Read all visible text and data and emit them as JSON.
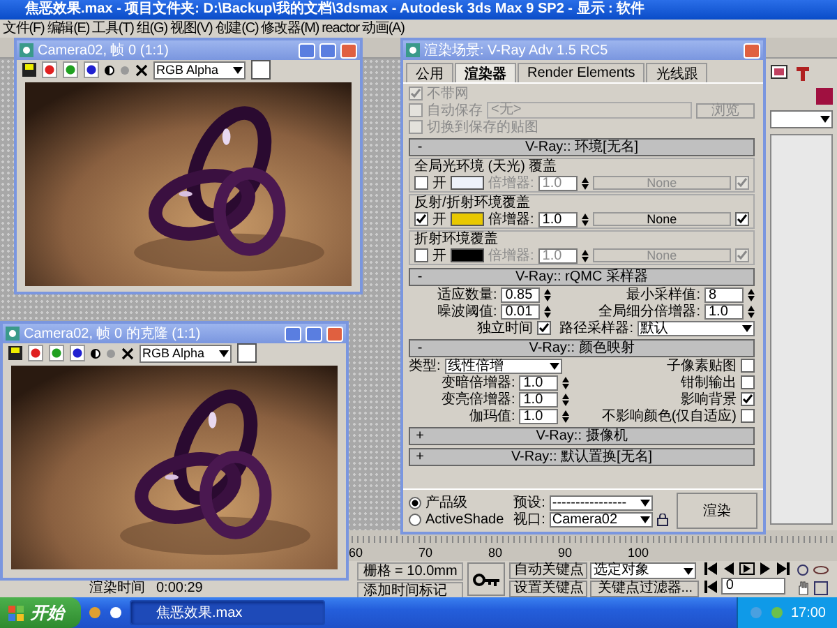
{
  "app_window": {
    "title": "焦恶效果.max    - 项目文件夹: D:\\Backup\\我的文档\\3dsmax    - Autodesk 3ds Max 9 SP2    - 显示 : 软件"
  },
  "menu": [
    "文件(F)",
    "编辑(E)",
    "工具(T)",
    "组(G)",
    "视图(V)",
    "创建(C)",
    "修改器(M)",
    "reactor",
    "动画(A)"
  ],
  "frame_windows": [
    {
      "title": "Camera02, 帧 0 (1:1)",
      "channel": "RGB Alpha"
    },
    {
      "title": "Camera02, 帧 0 的克隆 (1:1)",
      "channel": "RGB Alpha"
    }
  ],
  "render_dialog": {
    "title": "渲染场景: V-Ray Adv 1.5 RC5",
    "tabs": [
      {
        "label": "公用",
        "selected": false
      },
      {
        "label": "渲染器",
        "selected": true
      },
      {
        "label": "Render Elements",
        "selected": false
      },
      {
        "label": "光线跟",
        "selected": false
      }
    ],
    "output_options": [
      {
        "label": "不带网",
        "checked": true
      },
      {
        "label": "自动保存",
        "checked": false,
        "field": "<无>",
        "button": "浏览"
      },
      {
        "label": "切换到保存的贴图",
        "checked": false
      }
    ],
    "rollouts": [
      {
        "kind": "environment",
        "sign": "-",
        "title": "V-Ray:: 环境[无名]",
        "groups": [
          {
            "title": "全局光环境 (天光) 覆盖",
            "on_label": "开",
            "on": false,
            "color": "#eef2fa",
            "multiplier_label": "倍增器:",
            "multiplier": "1.0",
            "map": "None",
            "map_on": true
          },
          {
            "title": "反射/折射环境覆盖",
            "on_label": "开",
            "on": true,
            "color": "#e8c800",
            "multiplier_label": "倍增器:",
            "multiplier": "1.0",
            "map": "None",
            "map_on": true
          },
          {
            "title": "折射环境覆盖",
            "on_label": "开",
            "on": false,
            "color": "#000000",
            "multiplier_label": "倍增器:",
            "multiplier": "1.0",
            "map": "None",
            "map_on": true
          }
        ]
      },
      {
        "kind": "sampler",
        "sign": "-",
        "title": "V-Ray:: rQMC 采样器",
        "left": [
          {
            "label": "适应数量:",
            "value": "0.85"
          },
          {
            "label": "噪波阈值:",
            "value": "0.01"
          }
        ],
        "independent": {
          "label": "独立时间",
          "checked": true
        },
        "right": [
          {
            "label": "最小采样值:",
            "value": "8"
          },
          {
            "label": "全局细分倍增器:",
            "value": "1.0"
          }
        ],
        "path_sampler": {
          "label": "路径采样器:",
          "value": "默认"
        }
      },
      {
        "kind": "color_mapping",
        "sign": "-",
        "title": "V-Ray:: 颜色映射",
        "type_label": "类型:",
        "type": "线性倍增",
        "fields": [
          {
            "label": "变暗倍增器:",
            "value": "1.0"
          },
          {
            "label": "变亮倍增器:",
            "value": "1.0"
          },
          {
            "label": "伽玛值:",
            "value": "1.0"
          }
        ],
        "options": [
          {
            "label": "子像素贴图",
            "checked": false
          },
          {
            "label": "钳制输出",
            "checked": false
          },
          {
            "label": "影响背景",
            "checked": true
          },
          {
            "label": "不影响颜色(仅自适应)",
            "checked": false
          }
        ]
      },
      {
        "kind": "collapsed",
        "sign": "+",
        "title": "V-Ray:: 摄像机"
      },
      {
        "kind": "collapsed",
        "sign": "+",
        "title": "V-Ray:: 默认置换[无名]"
      }
    ],
    "modes": [
      {
        "label": "产品级",
        "selected": true
      },
      {
        "label": "ActiveShade",
        "selected": false
      }
    ],
    "preset": {
      "label": "预设:",
      "value": "----------------"
    },
    "viewport": {
      "label": "视口:",
      "value": "Camera02"
    },
    "render_button": "渲染"
  },
  "timeline": {
    "ticks": [
      "60",
      "70",
      "80",
      "90",
      "100"
    ]
  },
  "status": {
    "render_time_label": "渲染时间",
    "render_time": "0:00:29",
    "grid": "栅格 = 10.0mm",
    "add_time_tag": "添加时间标记",
    "auto_key": "自动关键点",
    "set_key": "设置关键点",
    "selection": "选定对象",
    "key_filters": "关键点过滤器...",
    "frame": "0"
  },
  "taskbar": {
    "start": "开始",
    "tasks": [
      {
        "label": "焦恶效果.max",
        "selected": true
      }
    ],
    "clock": "17:00"
  }
}
